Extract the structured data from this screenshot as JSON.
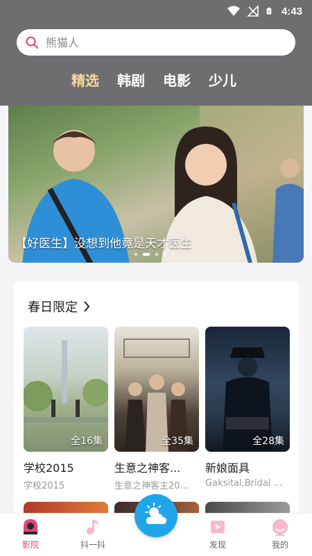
{
  "status": {
    "time": "4:43"
  },
  "search": {
    "placeholder": "熊猫人"
  },
  "tabs": [
    {
      "label": "精选",
      "active": true
    },
    {
      "label": "韩剧",
      "active": false
    },
    {
      "label": "电影",
      "active": false
    },
    {
      "label": "少儿",
      "active": false
    }
  ],
  "banner": {
    "caption": "【好医生】没想到他竟是天才医生",
    "dot_count": 5,
    "active_dot": 1
  },
  "section": {
    "title": "春日限定",
    "items": [
      {
        "title": "学校2015",
        "subtitle": "学校2015",
        "episodes": "全16集"
      },
      {
        "title": "生意之神客...",
        "subtitle": "生意之神客主20...",
        "episodes": "全35集"
      },
      {
        "title": "新娘面具",
        "subtitle": "Gaksital,Bridal ...",
        "episodes": "全28集"
      }
    ]
  },
  "nav": {
    "items": [
      {
        "label": "影院",
        "icon": "cinema-icon",
        "active": true
      },
      {
        "label": "抖一抖",
        "icon": "music-note-icon",
        "active": false
      },
      {
        "label": "",
        "icon": "weather-icon",
        "active": false
      },
      {
        "label": "发现",
        "icon": "play-icon",
        "active": false
      },
      {
        "label": "我的",
        "icon": "profile-icon",
        "active": false
      }
    ]
  },
  "colors": {
    "header": "#6e6e70",
    "active_tab": "#f7d89a",
    "accent": "#e2447a",
    "center_button": "#20a6e8"
  }
}
